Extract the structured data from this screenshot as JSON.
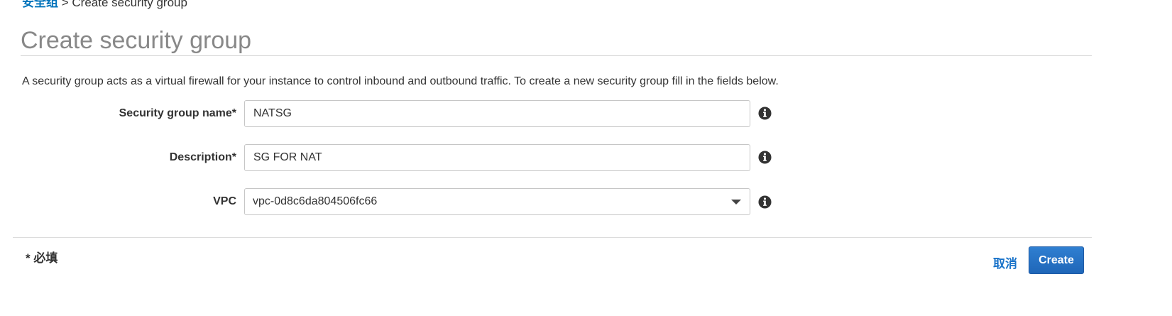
{
  "breadcrumb": {
    "parent_label": "安全组",
    "separator": ">",
    "current_label": "Create security group"
  },
  "page": {
    "title": "Create security group",
    "intro": "A security group acts as a virtual firewall for your instance to control inbound and outbound traffic. To create a new security group fill in the fields below."
  },
  "form": {
    "name_label": "Security group name*",
    "name_value": "NATSG",
    "description_label": "Description*",
    "description_value": "SG FOR NAT",
    "vpc_label": "VPC",
    "vpc_value": "vpc-0d8c6da804506fc66",
    "info_icon": "info-circle-icon",
    "caret_icon": "caret-down-icon"
  },
  "footer": {
    "required_note": "* 必填",
    "cancel_label": "取消",
    "create_label": "Create"
  },
  "colors": {
    "link": "#0073bb",
    "primary_button": "#1f66b8",
    "title": "#888888"
  }
}
